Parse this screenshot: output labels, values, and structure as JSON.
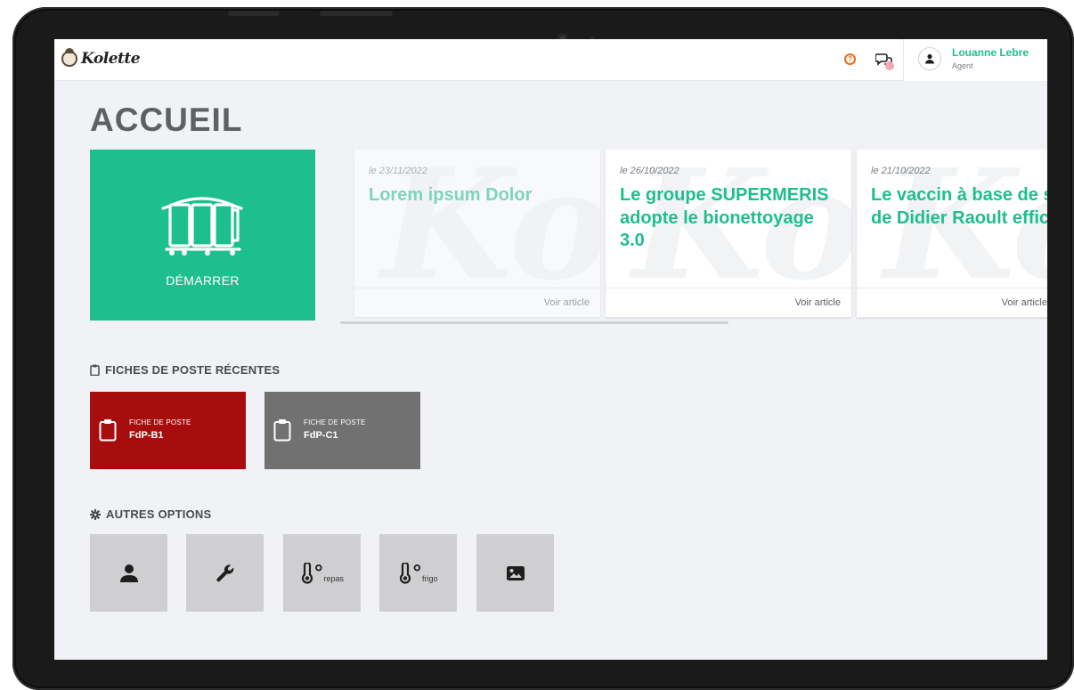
{
  "app": {
    "logo_text": "Kolette"
  },
  "header": {
    "help_icon": "question-circle-icon",
    "chat_icon": "chat-bubbles-icon",
    "user": {
      "name": "Louanne Lebre",
      "role": "Agent",
      "avatar_icon": "user-icon"
    }
  },
  "page": {
    "title": "ACCUEIL"
  },
  "start_tile": {
    "label": "DÉMARRER",
    "icon": "cleaning-cart-icon",
    "color": "#1dbf8e"
  },
  "articles": [
    {
      "date": "le 23/11/2022",
      "headline": "Lorem ipsum Dolor",
      "link_label": "Voir article"
    },
    {
      "date": "le 26/10/2022",
      "headline": "Le groupe SUPERMERIS adopte le bionettoyage 3.0",
      "link_label": "Voir article"
    },
    {
      "date": "le 21/10/2022",
      "headline": "Le vaccin à base de sang de Didier Raoult efficace...",
      "link_label": "Voir article"
    }
  ],
  "recent_sheets": {
    "title": "FICHES DE POSTE RÉCENTES",
    "icon": "clipboard-icon",
    "items": [
      {
        "kind": "FICHE DE POSTE",
        "code": "FdP-B1",
        "color": "#a80d0d"
      },
      {
        "kind": "FICHE DE POSTE",
        "code": "FdP-C1",
        "color": "#717171"
      }
    ]
  },
  "other_options": {
    "title": "AUTRES OPTIONS",
    "icon": "gear-icon",
    "items": [
      {
        "icon": "user-icon"
      },
      {
        "icon": "wrench-icon"
      },
      {
        "icon": "thermometer-icon",
        "degree": "°",
        "sub": "repas"
      },
      {
        "icon": "thermometer-icon",
        "degree": "°",
        "sub": "frigo"
      },
      {
        "icon": "image-icon"
      }
    ]
  },
  "colors": {
    "accent": "#1dbf8e",
    "help": "#ef6c1a",
    "background": "#f1f2f6",
    "title": "#5f6063"
  }
}
